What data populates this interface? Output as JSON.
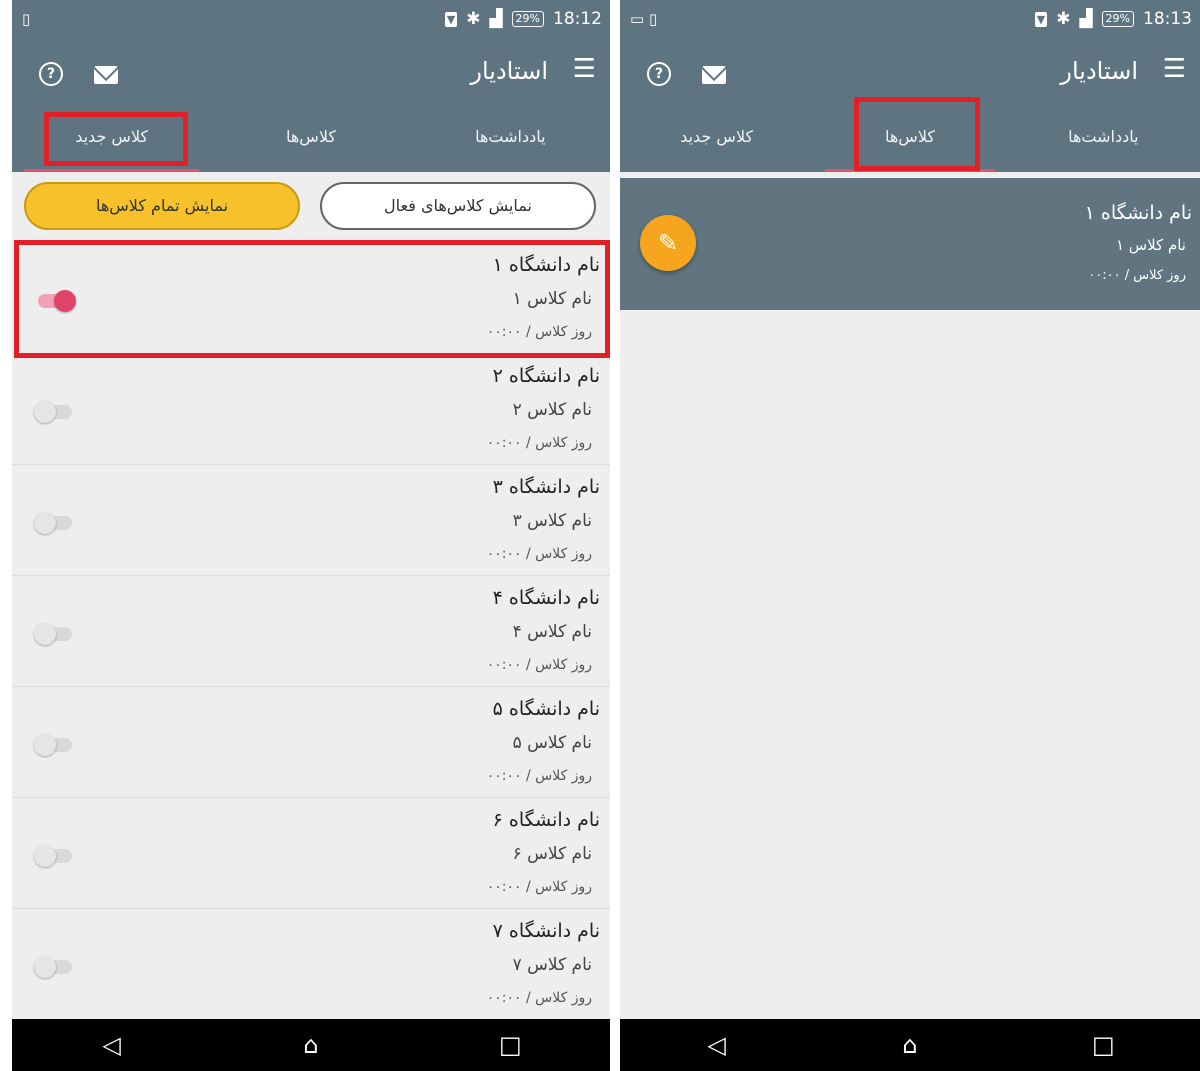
{
  "left_screen": {
    "status_bar": {
      "time": "18:12",
      "battery": "29%",
      "signal": "LTE"
    },
    "app_title": "استادیار",
    "tabs": [
      {
        "label": "یادداشت‌ها"
      },
      {
        "label": "کلاس‌ها"
      },
      {
        "label": "کلاس جدید",
        "active": true,
        "highlighted": true
      }
    ],
    "filters": {
      "active_classes": "نمایش کلاس‌های فعال",
      "all_classes": "نمایش تمام کلاس‌ها",
      "selected": "all_classes"
    },
    "classes": [
      {
        "university": "نام دانشگاه ۱",
        "class_name": "نام کلاس ۱",
        "day_time": "روز کلاس / ۰۰:۰۰",
        "enabled": true
      },
      {
        "university": "نام دانشگاه ۲",
        "class_name": "نام کلاس ۲",
        "day_time": "روز کلاس / ۰۰:۰۰",
        "enabled": false
      },
      {
        "university": "نام دانشگاه ۳",
        "class_name": "نام کلاس ۳",
        "day_time": "روز کلاس / ۰۰:۰۰",
        "enabled": false
      },
      {
        "university": "نام دانشگاه ۴",
        "class_name": "نام کلاس ۴",
        "day_time": "روز کلاس / ۰۰:۰۰",
        "enabled": false
      },
      {
        "university": "نام دانشگاه ۵",
        "class_name": "نام کلاس ۵",
        "day_time": "روز کلاس / ۰۰:۰۰",
        "enabled": false
      },
      {
        "university": "نام دانشگاه ۶",
        "class_name": "نام کلاس ۶",
        "day_time": "روز کلاس / ۰۰:۰۰",
        "enabled": false
      },
      {
        "university": "نام دانشگاه ۷",
        "class_name": "نام کلاس ۷",
        "day_time": "روز کلاس / ۰۰:۰۰",
        "enabled": false
      }
    ]
  },
  "right_screen": {
    "status_bar": {
      "time": "18:13",
      "battery": "29%",
      "signal": "LTE"
    },
    "app_title": "استادیار",
    "tabs": [
      {
        "label": "یادداشت‌ها"
      },
      {
        "label": "کلاس‌ها",
        "active": true,
        "highlighted": true
      },
      {
        "label": "کلاس جدید"
      }
    ],
    "card": {
      "university": "نام دانشگاه ۱",
      "class_name": "نام کلاس ۱",
      "day_time": "روز کلاس / ۰۰:۰۰"
    }
  },
  "icons": {
    "menu": "hamburger-icon",
    "help": "help-circle-icon",
    "mail": "mail-icon",
    "edit": "pencil-icon",
    "nav": [
      "back-icon",
      "home-icon",
      "recents-icon"
    ]
  },
  "colors": {
    "appbar": "#5e7480",
    "tab_indicator": "#e84e6e",
    "highlight": "#e01f26",
    "active_pill": "#f6c12a",
    "fab": "#f6a51f",
    "toggle_on": "#e0426a",
    "card": "#60757f"
  }
}
